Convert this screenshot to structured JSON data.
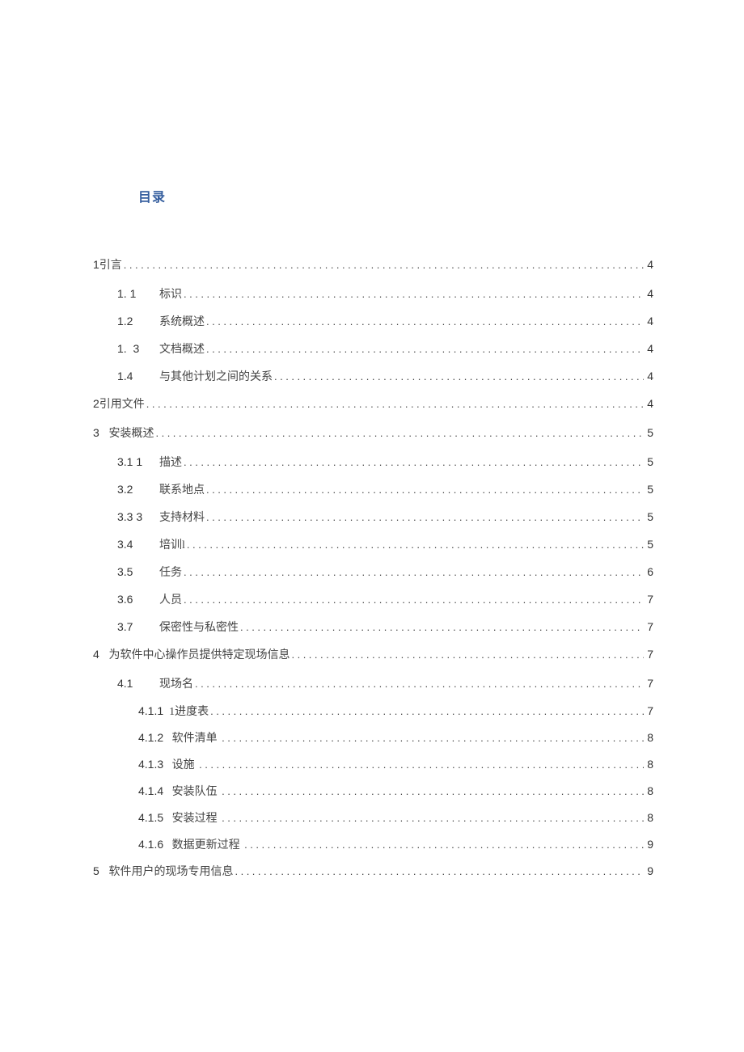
{
  "title": "目录",
  "entries": [
    {
      "lvl": 0,
      "num": "1",
      "label": "引言",
      "page": "4"
    },
    {
      "lvl": 1,
      "num": "1. 1",
      "label": "标识",
      "page": "4"
    },
    {
      "lvl": 1,
      "num": "1.2",
      "label": "系统概述",
      "page": "4"
    },
    {
      "lvl": 1,
      "num": "1.  3",
      "label": "文档概述",
      "page": "4"
    },
    {
      "lvl": 1,
      "num": "1.4",
      "label": "与其他计划之间的关系",
      "page": "4"
    },
    {
      "lvl": 0,
      "num": "2",
      "label": "引用文件",
      "page": "4"
    },
    {
      "lvl": 0,
      "num": "3   ",
      "label": "安装概述",
      "page": "5"
    },
    {
      "lvl": 1,
      "num": "3.1 1",
      "label": "描述",
      "page": "5"
    },
    {
      "lvl": 1,
      "num": "3.2",
      "label": "联系地点",
      "page": "5"
    },
    {
      "lvl": 1,
      "num": "3.3 3",
      "label": "支持材料",
      "page": "5"
    },
    {
      "lvl": 1,
      "num": "3.4",
      "label": "培训l",
      "page": "5"
    },
    {
      "lvl": 1,
      "num": "3.5",
      "label": "任务",
      "page": "6"
    },
    {
      "lvl": 1,
      "num": "3.6",
      "label": "人员",
      "page": "7"
    },
    {
      "lvl": 1,
      "num": "3.7",
      "label": "保密性与私密性",
      "page": "7"
    },
    {
      "lvl": 0,
      "num": "4   ",
      "label": "为软件中心操作员提供特定现场信息",
      "page": "7"
    },
    {
      "lvl": 1,
      "num": "4.1",
      "label": "现场名",
      "page": "7"
    },
    {
      "lvl": 2,
      "num": "4.1.1",
      "label": "  1进度表",
      "page": "7"
    },
    {
      "lvl": 2,
      "num": "4.1.2",
      "label": "   软件清单 ",
      "page": "8"
    },
    {
      "lvl": 2,
      "num": "4.1.3",
      "label": "   设施 ",
      "page": "8"
    },
    {
      "lvl": 2,
      "num": "4.1.4",
      "label": "   安装队伍 ",
      "page": "8"
    },
    {
      "lvl": 2,
      "num": "4.1.5",
      "label": "   安装过程 ",
      "page": "8"
    },
    {
      "lvl": 2,
      "num": "4.1.6",
      "label": "   数据更新过程 ",
      "page": "9"
    },
    {
      "lvl": 0,
      "num": "5   ",
      "label": "软件用户的现场专用信息",
      "page": "9"
    }
  ]
}
